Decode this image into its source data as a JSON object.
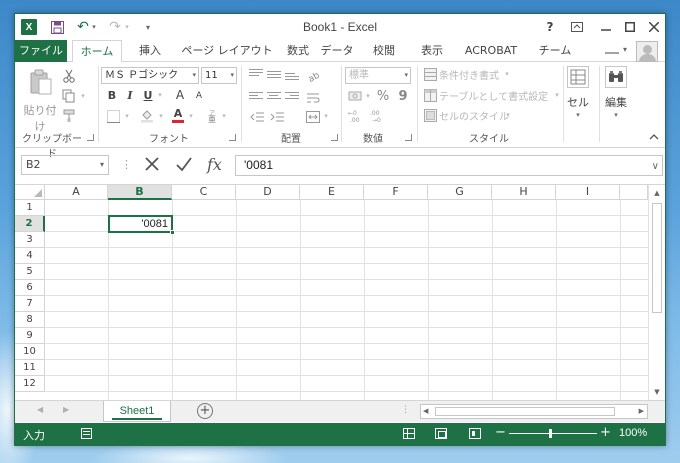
{
  "titlebar": {
    "title": "Book1 - Excel",
    "app_icon_letter": "X",
    "help": "?"
  },
  "tabs": {
    "file": "ファイル",
    "home": "ホーム",
    "insert": "挿入",
    "page_layout": "ページ レイアウト",
    "formulas": "数式",
    "data": "データ",
    "review": "校閲",
    "view": "表示",
    "acrobat": "ACROBAT",
    "team": "チーム"
  },
  "ribbon": {
    "clipboard": {
      "paste": "貼り付け",
      "label": "クリップボード"
    },
    "font": {
      "font_name": "ＭＳ Ｐゴシック",
      "font_size": "11",
      "bold": "B",
      "italic": "I",
      "underline": "U",
      "grow": "A",
      "shrink": "A",
      "font_color": "A",
      "label": "フォント"
    },
    "alignment": {
      "label": "配置"
    },
    "number": {
      "format": "標準",
      "percent": "%",
      "comma": "9",
      "label": "数値"
    },
    "styles": {
      "conditional": "条件付き書式",
      "as_table": "テーブルとして書式設定",
      "cell_styles": "セルのスタイル",
      "label": "スタイル"
    },
    "cells": {
      "label": "セル"
    },
    "editing": {
      "label": "編集"
    }
  },
  "formula_bar": {
    "name_box": "B2",
    "content": "'0081"
  },
  "grid": {
    "columns": [
      "A",
      "B",
      "C",
      "D",
      "E",
      "F",
      "G",
      "H",
      "I"
    ],
    "rows": [
      "1",
      "2",
      "3",
      "4",
      "5",
      "6",
      "7",
      "8",
      "9",
      "10",
      "11",
      "12"
    ],
    "selected_column": "B",
    "selected_row": "2",
    "cell_b2": "'0081"
  },
  "sheets": {
    "active_tab": "Sheet1"
  },
  "status": {
    "mode": "入力",
    "zoom": "100%"
  },
  "colors": {
    "accent": "#1e7145",
    "grid": "#e1e1e1"
  }
}
